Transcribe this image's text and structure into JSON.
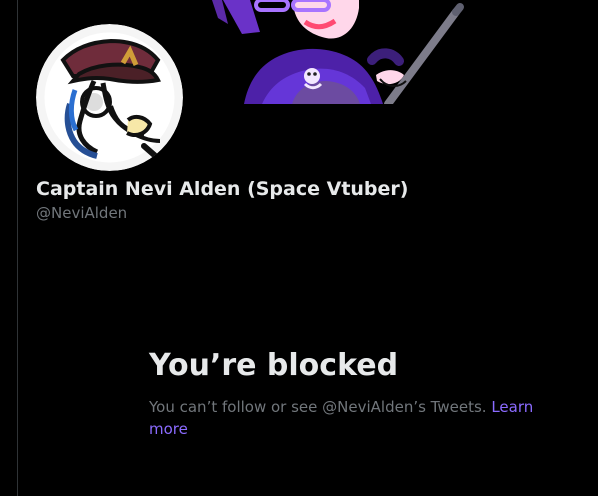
{
  "profile": {
    "display_name": "Captain Nevi Alden (Space Vtuber)",
    "handle": "@NeviAlden",
    "avatar_description_icon": "avatar-icon",
    "banner_icon": "banner-illustration-icon"
  },
  "blocked": {
    "title": "You’re blocked",
    "message": "You can’t follow or see @NeviAlden’s Tweets.",
    "learn_more_label": "Learn more"
  },
  "colors": {
    "background": "#000000",
    "primary_text": "#e7e9ea",
    "secondary_text": "#71767b",
    "link": "#8b6bff",
    "border": "#2f3336"
  }
}
